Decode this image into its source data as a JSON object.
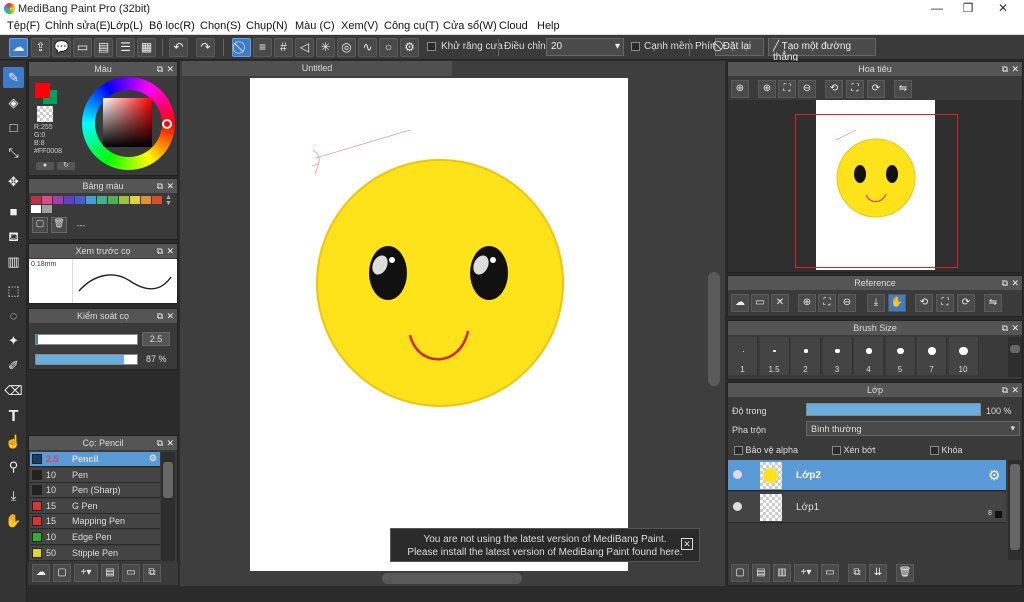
{
  "app": {
    "title": "MediBang Paint Pro (32bit)"
  },
  "window_controls": {
    "minimize": "—",
    "maximize": "❐",
    "close": "✕"
  },
  "menu": [
    "Tệp(F)",
    "Chỉnh sửa(E)",
    "Lớp(L)",
    "Bộ lọc(R)",
    "Chọn(S)",
    "Chụp(N)",
    "Màu (C)",
    "Xem(V)",
    "Công cụ(T)",
    "Cửa sổ(W)",
    "Cloud",
    "Help"
  ],
  "toolbar": {
    "antialias_label": "Khử răng cưa",
    "adjust_label": "Điều chỉnh",
    "adjust_value": "20",
    "edge_label": "Cạnh mềm",
    "key_label": "Phím",
    "reset_label": "Đặt lại",
    "straight_line_label": "Tạo một đường thẳng"
  },
  "color_panel": {
    "title": "Màu",
    "r": "R:255",
    "g": "G:0",
    "b": "B:8",
    "hex": "#FF0008"
  },
  "palette_panel": {
    "title": "Bảng màu",
    "dash": "---",
    "swatches": [
      "#c0304a",
      "#d84a8a",
      "#a040b0",
      "#6040c0",
      "#4060d0",
      "#40a0d0",
      "#40b090",
      "#50b050",
      "#a0c040",
      "#e0d040",
      "#e09030",
      "#d05030",
      "#ffffff",
      "#a0a0a0"
    ]
  },
  "brush_preview": {
    "title": "Xem trước cọ",
    "size": "0.18mm"
  },
  "brush_control": {
    "title": "Kiểm soát cọ",
    "size_value": "2.5",
    "opacity_value": "87 %",
    "opacity": 0.87
  },
  "brush_panel": {
    "title": "Cọ: Pencil",
    "items": [
      {
        "size": "2.5",
        "name": "Pencil",
        "color": "#1a3a6a"
      },
      {
        "size": "10",
        "name": "Pen",
        "color": "#222222"
      },
      {
        "size": "10",
        "name": "Pen (Sharp)",
        "color": "#222222"
      },
      {
        "size": "15",
        "name": "G Pen",
        "color": "#e03030"
      },
      {
        "size": "15",
        "name": "Mapping Pen",
        "color": "#e03030"
      },
      {
        "size": "10",
        "name": "Edge Pen",
        "color": "#30b030"
      },
      {
        "size": "50",
        "name": "Stipple Pen",
        "color": "#e0d030"
      }
    ]
  },
  "canvas": {
    "tab": "Untitled"
  },
  "notice": {
    "line1": "You are not using the latest version of MediBang Paint.",
    "line2": "Please install the latest version of MediBang Paint found here."
  },
  "navigator": {
    "title": "Hoa tiêu"
  },
  "reference": {
    "title": "Reference"
  },
  "brush_size": {
    "title": "Brush Size",
    "sizes": [
      "1",
      "1.5",
      "2",
      "3",
      "4",
      "5",
      "7",
      "10"
    ]
  },
  "layers": {
    "title": "Lớp",
    "opacity_label": "Độ trong",
    "opacity_value": "100 %",
    "blend_label": "Pha trộn",
    "blend_value": "Bình thường",
    "protect_alpha": "Bảo vệ alpha",
    "clip": "Xén bớt",
    "lock": "Khóa",
    "items": [
      {
        "name": "Lớp2"
      },
      {
        "name": "Lớp1",
        "badge": "8"
      }
    ]
  },
  "colors": {
    "accent": "#3d7cc9",
    "face": "#ffe31a",
    "face_edge": "#f2c30a",
    "primary": "#ff0008",
    "secondary": "#00a060"
  }
}
